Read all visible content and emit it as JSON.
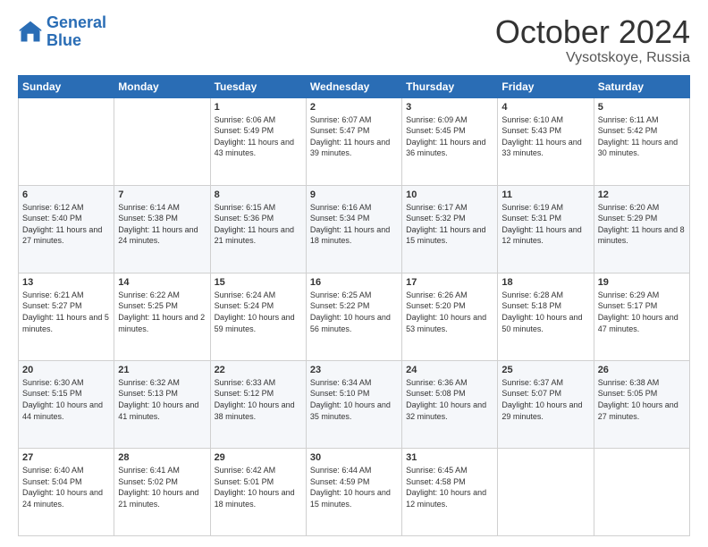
{
  "header": {
    "logo_line1": "General",
    "logo_line2": "Blue",
    "month": "October 2024",
    "location": "Vysotskoye, Russia"
  },
  "weekdays": [
    "Sunday",
    "Monday",
    "Tuesday",
    "Wednesday",
    "Thursday",
    "Friday",
    "Saturday"
  ],
  "weeks": [
    [
      {
        "day": "",
        "info": ""
      },
      {
        "day": "",
        "info": ""
      },
      {
        "day": "1",
        "info": "Sunrise: 6:06 AM\nSunset: 5:49 PM\nDaylight: 11 hours and 43 minutes."
      },
      {
        "day": "2",
        "info": "Sunrise: 6:07 AM\nSunset: 5:47 PM\nDaylight: 11 hours and 39 minutes."
      },
      {
        "day": "3",
        "info": "Sunrise: 6:09 AM\nSunset: 5:45 PM\nDaylight: 11 hours and 36 minutes."
      },
      {
        "day": "4",
        "info": "Sunrise: 6:10 AM\nSunset: 5:43 PM\nDaylight: 11 hours and 33 minutes."
      },
      {
        "day": "5",
        "info": "Sunrise: 6:11 AM\nSunset: 5:42 PM\nDaylight: 11 hours and 30 minutes."
      }
    ],
    [
      {
        "day": "6",
        "info": "Sunrise: 6:12 AM\nSunset: 5:40 PM\nDaylight: 11 hours and 27 minutes."
      },
      {
        "day": "7",
        "info": "Sunrise: 6:14 AM\nSunset: 5:38 PM\nDaylight: 11 hours and 24 minutes."
      },
      {
        "day": "8",
        "info": "Sunrise: 6:15 AM\nSunset: 5:36 PM\nDaylight: 11 hours and 21 minutes."
      },
      {
        "day": "9",
        "info": "Sunrise: 6:16 AM\nSunset: 5:34 PM\nDaylight: 11 hours and 18 minutes."
      },
      {
        "day": "10",
        "info": "Sunrise: 6:17 AM\nSunset: 5:32 PM\nDaylight: 11 hours and 15 minutes."
      },
      {
        "day": "11",
        "info": "Sunrise: 6:19 AM\nSunset: 5:31 PM\nDaylight: 11 hours and 12 minutes."
      },
      {
        "day": "12",
        "info": "Sunrise: 6:20 AM\nSunset: 5:29 PM\nDaylight: 11 hours and 8 minutes."
      }
    ],
    [
      {
        "day": "13",
        "info": "Sunrise: 6:21 AM\nSunset: 5:27 PM\nDaylight: 11 hours and 5 minutes."
      },
      {
        "day": "14",
        "info": "Sunrise: 6:22 AM\nSunset: 5:25 PM\nDaylight: 11 hours and 2 minutes."
      },
      {
        "day": "15",
        "info": "Sunrise: 6:24 AM\nSunset: 5:24 PM\nDaylight: 10 hours and 59 minutes."
      },
      {
        "day": "16",
        "info": "Sunrise: 6:25 AM\nSunset: 5:22 PM\nDaylight: 10 hours and 56 minutes."
      },
      {
        "day": "17",
        "info": "Sunrise: 6:26 AM\nSunset: 5:20 PM\nDaylight: 10 hours and 53 minutes."
      },
      {
        "day": "18",
        "info": "Sunrise: 6:28 AM\nSunset: 5:18 PM\nDaylight: 10 hours and 50 minutes."
      },
      {
        "day": "19",
        "info": "Sunrise: 6:29 AM\nSunset: 5:17 PM\nDaylight: 10 hours and 47 minutes."
      }
    ],
    [
      {
        "day": "20",
        "info": "Sunrise: 6:30 AM\nSunset: 5:15 PM\nDaylight: 10 hours and 44 minutes."
      },
      {
        "day": "21",
        "info": "Sunrise: 6:32 AM\nSunset: 5:13 PM\nDaylight: 10 hours and 41 minutes."
      },
      {
        "day": "22",
        "info": "Sunrise: 6:33 AM\nSunset: 5:12 PM\nDaylight: 10 hours and 38 minutes."
      },
      {
        "day": "23",
        "info": "Sunrise: 6:34 AM\nSunset: 5:10 PM\nDaylight: 10 hours and 35 minutes."
      },
      {
        "day": "24",
        "info": "Sunrise: 6:36 AM\nSunset: 5:08 PM\nDaylight: 10 hours and 32 minutes."
      },
      {
        "day": "25",
        "info": "Sunrise: 6:37 AM\nSunset: 5:07 PM\nDaylight: 10 hours and 29 minutes."
      },
      {
        "day": "26",
        "info": "Sunrise: 6:38 AM\nSunset: 5:05 PM\nDaylight: 10 hours and 27 minutes."
      }
    ],
    [
      {
        "day": "27",
        "info": "Sunrise: 6:40 AM\nSunset: 5:04 PM\nDaylight: 10 hours and 24 minutes."
      },
      {
        "day": "28",
        "info": "Sunrise: 6:41 AM\nSunset: 5:02 PM\nDaylight: 10 hours and 21 minutes."
      },
      {
        "day": "29",
        "info": "Sunrise: 6:42 AM\nSunset: 5:01 PM\nDaylight: 10 hours and 18 minutes."
      },
      {
        "day": "30",
        "info": "Sunrise: 6:44 AM\nSunset: 4:59 PM\nDaylight: 10 hours and 15 minutes."
      },
      {
        "day": "31",
        "info": "Sunrise: 6:45 AM\nSunset: 4:58 PM\nDaylight: 10 hours and 12 minutes."
      },
      {
        "day": "",
        "info": ""
      },
      {
        "day": "",
        "info": ""
      }
    ]
  ]
}
